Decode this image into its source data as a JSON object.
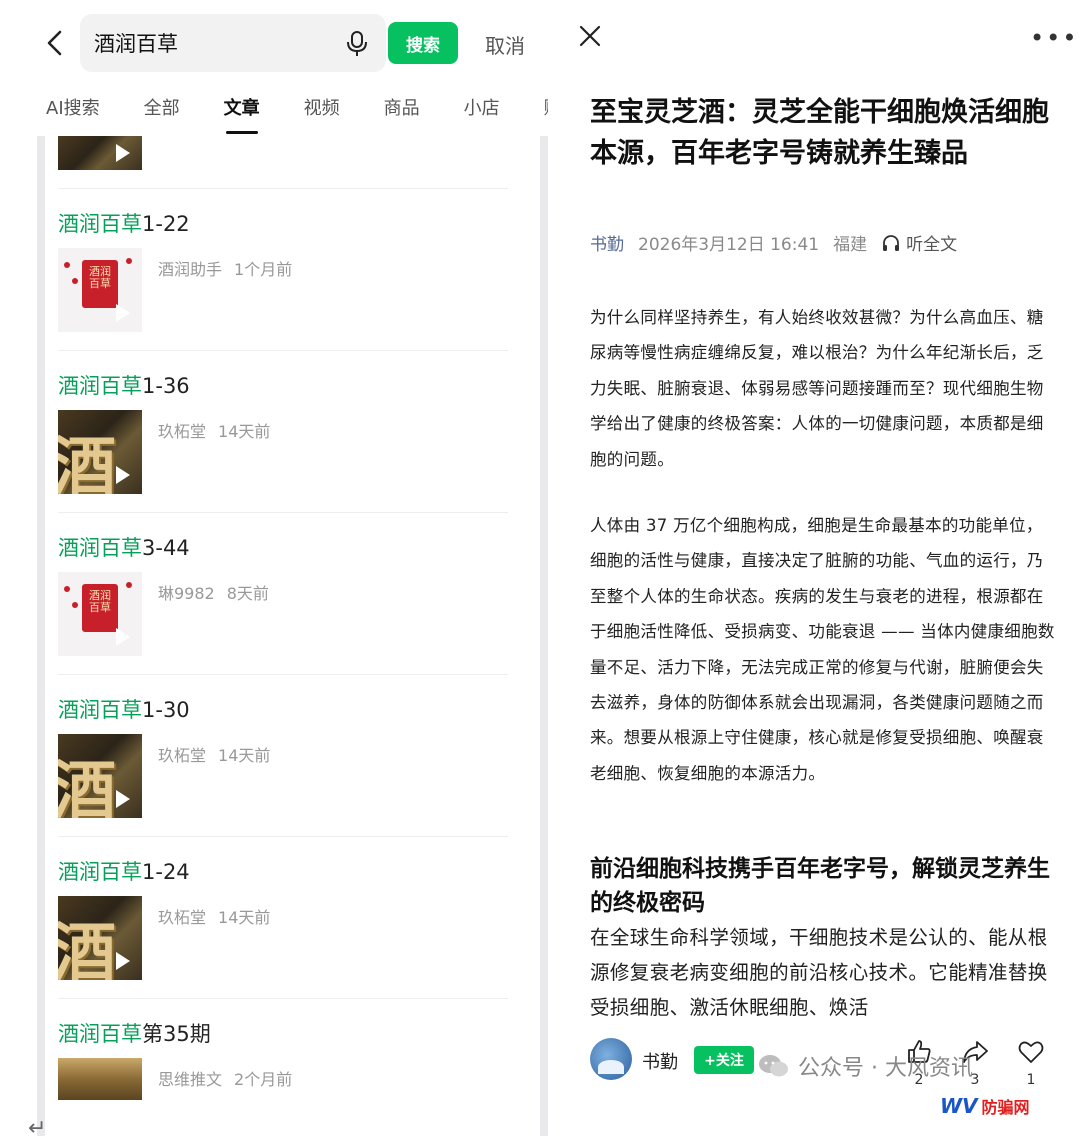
{
  "search": {
    "query": "酒润百草",
    "button_label": "搜索",
    "cancel_label": "取消"
  },
  "tabs": [
    {
      "label": "AI搜索"
    },
    {
      "label": "全部"
    },
    {
      "label": "文章",
      "active": true
    },
    {
      "label": "视频"
    },
    {
      "label": "商品"
    },
    {
      "label": "小店"
    },
    {
      "label": "账"
    }
  ],
  "results": [
    {
      "highlight": "酒润百草",
      "suffix": "1-22",
      "author": "酒润助手",
      "time": "1个月前",
      "thumb": "red-box"
    },
    {
      "highlight": "酒润百草",
      "suffix": "1-36",
      "author": "玖柘堂",
      "time": "14天前",
      "thumb": "gold-jiu"
    },
    {
      "highlight": "酒润百草",
      "suffix": "3-44",
      "author": "琳9982",
      "time": "8天前",
      "thumb": "red-box"
    },
    {
      "highlight": "酒润百草",
      "suffix": "1-30",
      "author": "玖柘堂",
      "time": "14天前",
      "thumb": "gold-jiu"
    },
    {
      "highlight": "酒润百草",
      "suffix": "1-24",
      "author": "玖柘堂",
      "time": "14天前",
      "thumb": "gold-jiu"
    },
    {
      "highlight": "酒润百草",
      "suffix": "第35期",
      "author": "思维推文",
      "time": "2个月前",
      "thumb": "field"
    }
  ],
  "thumb_text": {
    "jiu": "酒",
    "red_box": "酒润百草"
  },
  "article": {
    "title": "至宝灵芝酒：灵芝全能干细胞焕活细胞本源，百年老字号铸就养生臻品",
    "author": "书勤",
    "date": "2026年3月12日 16:41",
    "location": "福建",
    "listen_label": "听全文",
    "para1": "为什么同样坚持养生，有人始终收效甚微？为什么高血压、糖尿病等慢性病症缠绵反复，难以根治？为什么年纪渐长后，乏力失眠、脏腑衰退、体弱易感等问题接踵而至？现代细胞生物学给出了健康的终极答案：人体的一切健康问题，本质都是细胞的问题。",
    "para2": "人体由 37 万亿个细胞构成，细胞是生命最基本的功能单位，细胞的活性与健康，直接决定了脏腑的功能、气血的运行，乃至整个人体的生命状态。疾病的发生与衰老的进程，根源都在于细胞活性降低、受损病变、功能衰退 —— 当体内健康细胞数量不足、活力下降，无法完成正常的修复与代谢，脏腑便会失去滋养，身体的防御体系就会出现漏洞，各类健康问题随之而来。想要从根源上守住健康，核心就是修复受损细胞、唤醒衰老细胞、恢复细胞的本源活力。",
    "heading": "前沿细胞科技携手百年老字号，解锁灵芝养生的终极密码",
    "para3": "在全球生命科学领域，干细胞技术是公认的、能从根源修复衰老病变细胞的前沿核心技术。它能精准替换受损细胞、激活休眠细胞、焕活"
  },
  "footer": {
    "author": "书勤",
    "follow_label": "+关注",
    "likes": "2",
    "shares": "3",
    "favorites": "1"
  },
  "watermark": {
    "text": "公众号 · 大风资讯",
    "brand_latin": "WV",
    "brand_cn": "防骗网"
  },
  "colors": {
    "accent_green": "#07c160",
    "highlight_green": "#07a05a",
    "author_blue": "#576b95"
  }
}
